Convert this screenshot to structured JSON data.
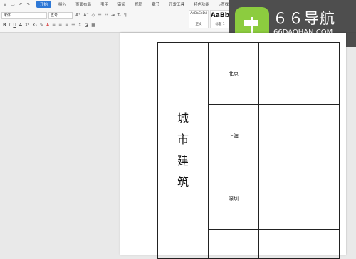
{
  "ribbon": {
    "tabs": [
      "开始",
      "插入",
      "页面布局",
      "引用",
      "审阅",
      "视图",
      "章节",
      "开发工具",
      "特色功能"
    ],
    "active_tab": "开始",
    "search_label": "查找",
    "font_name": "宋体",
    "font_size": "五号",
    "styles": [
      {
        "preview": "AaBbCcDd",
        "name": "正文"
      },
      {
        "preview": "AaBb",
        "name": "标题 1"
      }
    ]
  },
  "watermark": {
    "title": "６６导航",
    "subtitle": "66DAOHAN.COM",
    "logo_color": "#8ccc3f"
  },
  "document": {
    "table": {
      "label_chars": [
        "城",
        "市",
        "建",
        "筑"
      ],
      "cities": [
        "北京",
        "上海",
        "深圳"
      ]
    }
  }
}
